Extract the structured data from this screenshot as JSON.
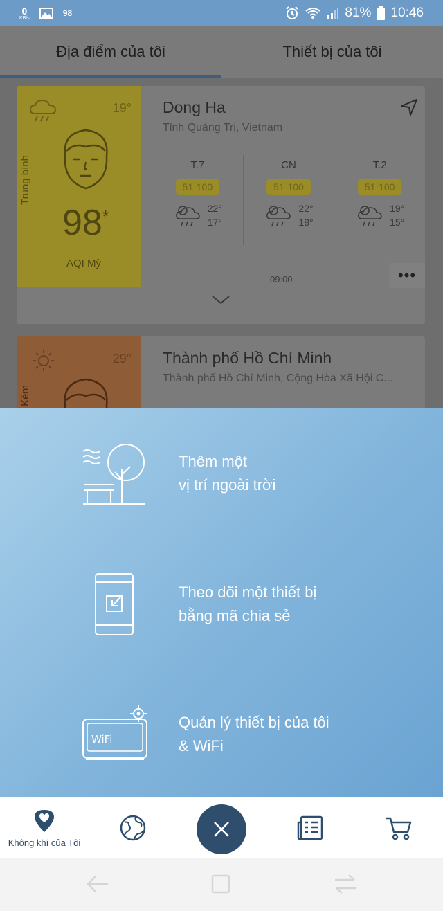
{
  "status_bar": {
    "speed": "0",
    "speed_unit": "KB/s",
    "notif_count": "98",
    "battery": "81%",
    "time": "10:46"
  },
  "tabs": [
    {
      "label": "Địa điểm của tôi",
      "active": true
    },
    {
      "label": "Thiết bị của tôi",
      "active": false
    }
  ],
  "cards": [
    {
      "temp": "19°",
      "level": "Trung bình",
      "aqi": "98",
      "aqi_label": "AQI Mỹ",
      "city": "Dong Ha",
      "region": "Tỉnh Quảng Trị, Vietnam",
      "forecast": [
        {
          "day": "T.7",
          "range": "51-100",
          "high": "22°",
          "low": "17°"
        },
        {
          "day": "CN",
          "range": "51-100",
          "high": "22°",
          "low": "18°"
        },
        {
          "day": "T.2",
          "range": "51-100",
          "high": "19°",
          "low": "15°"
        }
      ],
      "time": "09:00",
      "more": "•••"
    },
    {
      "temp": "29°",
      "level": "Kém",
      "city": "Thành phố Hồ Chí Minh",
      "region": "Thành phố Hồ Chí Minh, Cộng Hòa Xã Hội C..."
    }
  ],
  "sheet": {
    "options": [
      {
        "line1": "Thêm một",
        "line2": "vị trí ngoài trời",
        "icon": "park-bench-tree-icon"
      },
      {
        "line1": "Theo dõi một thiết bị",
        "line2": "bằng mã chia sẻ",
        "icon": "phone-share-icon"
      },
      {
        "line1": "Quản lý thiết bị của tôi",
        "line2": "& WiFi",
        "icon": "wifi-device-settings-icon",
        "device_text": "WiFi"
      }
    ]
  },
  "bottom_nav": {
    "my_air_label": "Không khí của Tôi"
  },
  "colors": {
    "accent": "#2f4e6e",
    "sheet_start": "#a9d0ea",
    "sheet_end": "#6aa3d2",
    "moderate": "#f5d131",
    "poor": "#f0924a"
  }
}
